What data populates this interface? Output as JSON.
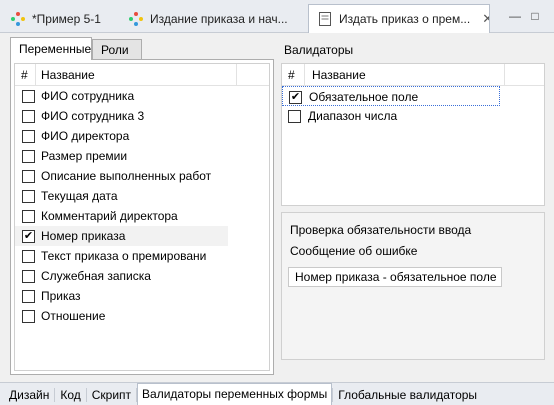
{
  "editor_tabs": [
    {
      "label": "*Пример 5-1",
      "icon": "process-icon"
    },
    {
      "label": "Издание приказа и нач...",
      "icon": "process-icon"
    },
    {
      "label": "Издать приказ о прем...",
      "icon": "form-icon",
      "active": true
    }
  ],
  "window_controls": {
    "minimize": "—",
    "maximize": "□"
  },
  "left_panel": {
    "tabs": [
      "Переменные",
      "Роли"
    ],
    "active_tab": "Переменные",
    "header_num": "#",
    "header_name": "Название",
    "rows": [
      {
        "label": "ФИО сотрудника",
        "checked": false
      },
      {
        "label": "ФИО сотрудника 3",
        "checked": false
      },
      {
        "label": "ФИО директора",
        "checked": false
      },
      {
        "label": "Размер премии",
        "checked": false
      },
      {
        "label": "Описание выполненных работ",
        "checked": false
      },
      {
        "label": "Текущая дата",
        "checked": false
      },
      {
        "label": "Комментарий директора",
        "checked": false
      },
      {
        "label": "Номер приказа",
        "checked": true,
        "selected": true
      },
      {
        "label": "Текст приказа о премировани",
        "checked": false
      },
      {
        "label": "Служебная записка",
        "checked": false
      },
      {
        "label": "Приказ",
        "checked": false
      },
      {
        "label": "Отношение",
        "checked": false
      }
    ]
  },
  "right_panel": {
    "title": "Валидаторы",
    "header_num": "#",
    "header_name": "Название",
    "rows": [
      {
        "label": "Обязательное поле",
        "checked": true,
        "focused": true
      },
      {
        "label": "Диапазон числа",
        "checked": false
      }
    ],
    "detail": {
      "line1": "Проверка обязательности ввода",
      "line2": "Сообщение об ошибке",
      "error_message": "Номер приказа - обязательное поле"
    }
  },
  "bottom_tabs": [
    {
      "label": "Дизайн"
    },
    {
      "label": "Код"
    },
    {
      "label": "Скрипт"
    },
    {
      "label": "Валидаторы переменных формы",
      "active": true
    },
    {
      "label": "Глобальные валидаторы"
    }
  ],
  "checkmark": "✔"
}
